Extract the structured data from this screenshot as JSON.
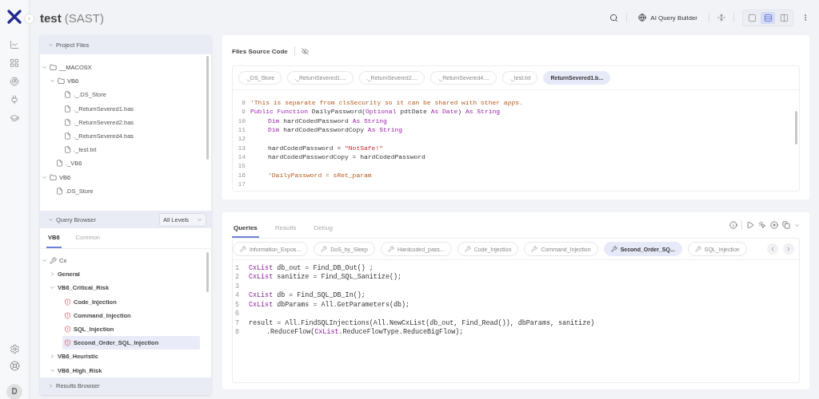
{
  "app": {
    "title": "test",
    "subtitle": "(SAST)",
    "avatar": "D"
  },
  "header": {
    "ai_button": "AI Query Builder",
    "view_modes": [
      {
        "kind": "single",
        "selected": false
      },
      {
        "kind": "rows",
        "selected": true
      },
      {
        "kind": "columns",
        "selected": false
      }
    ]
  },
  "project_files": {
    "title": "Project Files",
    "expanded": true,
    "tree": [
      {
        "kind": "folder",
        "label": "__MACOSX",
        "expanded": true,
        "children": [
          {
            "kind": "folder",
            "label": "VB6",
            "expanded": true,
            "children": [
              {
                "kind": "file",
                "label": "._.DS_Store"
              },
              {
                "kind": "file",
                "label": "._ReturnSevered1.bas"
              },
              {
                "kind": "file",
                "label": "._ReturnSevered2.bas"
              },
              {
                "kind": "file",
                "label": "._ReturnSevered4.bas"
              },
              {
                "kind": "file",
                "label": "._test.txt"
              }
            ]
          },
          {
            "kind": "file",
            "label": "._VB6"
          }
        ]
      },
      {
        "kind": "folder",
        "label": "VB6",
        "expanded": true,
        "children": [
          {
            "kind": "file",
            "label": ".DS_Store"
          }
        ]
      }
    ]
  },
  "query_browser": {
    "title": "Query Browser",
    "expanded": true,
    "level_filter": "All Levels",
    "tabs": [
      {
        "label": "VB6",
        "selected": true
      },
      {
        "label": "Common",
        "selected": false
      }
    ],
    "tree": [
      {
        "kind": "root",
        "label": "Cx",
        "expanded": true,
        "children": [
          {
            "kind": "group",
            "label": "General",
            "expanded": false
          },
          {
            "kind": "group",
            "label": "VB6_Critical_Risk",
            "expanded": true,
            "children": [
              {
                "kind": "query",
                "label": "Code_Injection",
                "selected": false
              },
              {
                "kind": "query",
                "label": "Command_Injection",
                "selected": false
              },
              {
                "kind": "query",
                "label": "SQL_Injection",
                "selected": false
              },
              {
                "kind": "query",
                "label": "Second_Order_SQL_Injection",
                "selected": true
              }
            ]
          },
          {
            "kind": "group",
            "label": "VB6_Heuristic",
            "expanded": false
          },
          {
            "kind": "group",
            "label": "VB6_High_Risk",
            "expanded": true
          }
        ]
      }
    ]
  },
  "results_browser": {
    "title": "Results Browser",
    "expanded": false
  },
  "source": {
    "title": "Files Source Code",
    "files": [
      {
        "label": "._DS_Store",
        "selected": false
      },
      {
        "label": "._ReturnSevered1....",
        "selected": false
      },
      {
        "label": "._ReturnSevered2....",
        "selected": false
      },
      {
        "label": "._ReturnSevered4....",
        "selected": false
      },
      {
        "label": "._test.txt",
        "selected": false
      },
      {
        "label": "ReturnSevered1.b...",
        "selected": true
      }
    ],
    "lines": [
      {
        "number": "8",
        "indented": false,
        "tokens": [
          {
            "kind": "comment",
            "text": "'This is separate from clsSecurity so it can be shared with other apps."
          }
        ]
      },
      {
        "number": "9",
        "indented": false,
        "tokens": [
          {
            "kind": "keyword",
            "text": "Public Function"
          },
          {
            "kind": "plain",
            "text": " DailyPassword("
          },
          {
            "kind": "keyword",
            "text": "Optional"
          },
          {
            "kind": "plain",
            "text": " pdtDate "
          },
          {
            "kind": "keyword",
            "text": "As Date"
          },
          {
            "kind": "plain",
            "text": ") "
          },
          {
            "kind": "keyword",
            "text": "As String"
          }
        ]
      },
      {
        "number": "10",
        "indented": true,
        "tokens": [
          {
            "kind": "keyword",
            "text": "Dim"
          },
          {
            "kind": "plain",
            "text": " hardCodedPassword "
          },
          {
            "kind": "keyword",
            "text": "As String"
          }
        ]
      },
      {
        "number": "11",
        "indented": true,
        "tokens": [
          {
            "kind": "keyword",
            "text": "Dim"
          },
          {
            "kind": "plain",
            "text": " hardCodedPasswordCopy "
          },
          {
            "kind": "keyword",
            "text": "As String"
          }
        ]
      },
      {
        "number": "12"
      },
      {
        "number": "13",
        "indented": true,
        "tokens": [
          {
            "kind": "plain",
            "text": "hardCodedPassword = "
          },
          {
            "kind": "string",
            "text": "\"NotSafe!\""
          }
        ]
      },
      {
        "number": "14",
        "indented": true,
        "tokens": [
          {
            "kind": "plain",
            "text": "hardCodedPasswordCopy = hardCodedPassword"
          }
        ]
      },
      {
        "number": "15"
      },
      {
        "number": "16",
        "indented": true,
        "tokens": [
          {
            "kind": "comment",
            "text": "'DailyPassword = sRet_param"
          }
        ]
      },
      {
        "number": "17"
      }
    ]
  },
  "editor": {
    "tabs": [
      {
        "label": "Queries",
        "selected": true
      },
      {
        "label": "Results",
        "selected": false
      },
      {
        "label": "Debug",
        "selected": false
      }
    ],
    "queries": [
      {
        "label": "Information_Expos...",
        "selected": false
      },
      {
        "label": "DoS_by_Sleep",
        "selected": false
      },
      {
        "label": "Hardcoded_pass...",
        "selected": false
      },
      {
        "label": "Code_Injection",
        "selected": false
      },
      {
        "label": "Command_Injection",
        "selected": false
      },
      {
        "label": "Second_Order_SQ...",
        "selected": true
      },
      {
        "label": "SQL_Injection",
        "selected": false
      }
    ],
    "lines": [
      {
        "number": "1",
        "indented": false,
        "tokens": [
          {
            "kind": "type",
            "text": "CxList"
          },
          {
            "kind": "plain",
            "text": " db_out = Find_DB_Out() ;"
          }
        ]
      },
      {
        "number": "2",
        "indented": false,
        "tokens": [
          {
            "kind": "type",
            "text": "CxList"
          },
          {
            "kind": "plain",
            "text": " sanitize = Find_SQL_Sanitize();"
          }
        ]
      },
      {
        "number": "3"
      },
      {
        "number": "4",
        "indented": false,
        "tokens": [
          {
            "kind": "type",
            "text": "CxList"
          },
          {
            "kind": "plain",
            "text": " db = Find_SQL_DB_In();"
          }
        ]
      },
      {
        "number": "5",
        "indented": false,
        "tokens": [
          {
            "kind": "type",
            "text": "CxList"
          },
          {
            "kind": "plain",
            "text": " dbParams = All.GetParameters(db);"
          }
        ]
      },
      {
        "number": "6"
      },
      {
        "number": "7",
        "indented": false,
        "tokens": [
          {
            "kind": "plain",
            "text": "result = All.FindSQLInjections(All.NewCxList(db_out, Find_Read()), dbParams, sanitize)"
          }
        ]
      },
      {
        "number": "8",
        "indented": true,
        "tokens": [
          {
            "kind": "plain",
            "text": ".ReduceFlow("
          },
          {
            "kind": "type",
            "text": "CxList"
          },
          {
            "kind": "plain",
            "text": ".ReduceFlowType.ReduceBigFlow);"
          }
        ]
      }
    ]
  }
}
